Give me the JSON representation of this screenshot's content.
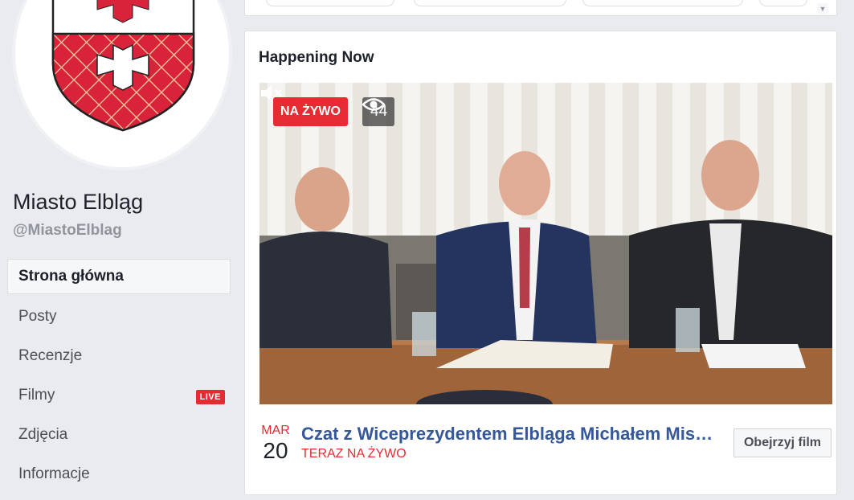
{
  "page": {
    "name": "Miasto Elbląg",
    "handle": "@MiastoElblag"
  },
  "nav": {
    "items": [
      {
        "label": "Strona główna",
        "active": true
      },
      {
        "label": "Posty"
      },
      {
        "label": "Recenzje"
      },
      {
        "label": "Filmy",
        "badge": "LIVE"
      },
      {
        "label": "Zdjęcia"
      },
      {
        "label": "Informacje"
      }
    ]
  },
  "happening_now": {
    "title": "Happening Now",
    "live_label": "NA ŻYWO",
    "viewer_count": "44",
    "event": {
      "month": "MAR",
      "day": "20",
      "title": "Czat z Wiceprezydentem Elbląga Michałem Missanem",
      "status": "TERAZ NA ŻYWO",
      "watch_button": "Obejrzyj film"
    }
  },
  "icons": {
    "viewers": "eye-icon",
    "mute": "muted-speaker-icon",
    "dropdown": "chevron-down-icon"
  },
  "colors": {
    "live_red": "#e62b33",
    "link_blue": "#365899",
    "background": "#e9ebee"
  }
}
